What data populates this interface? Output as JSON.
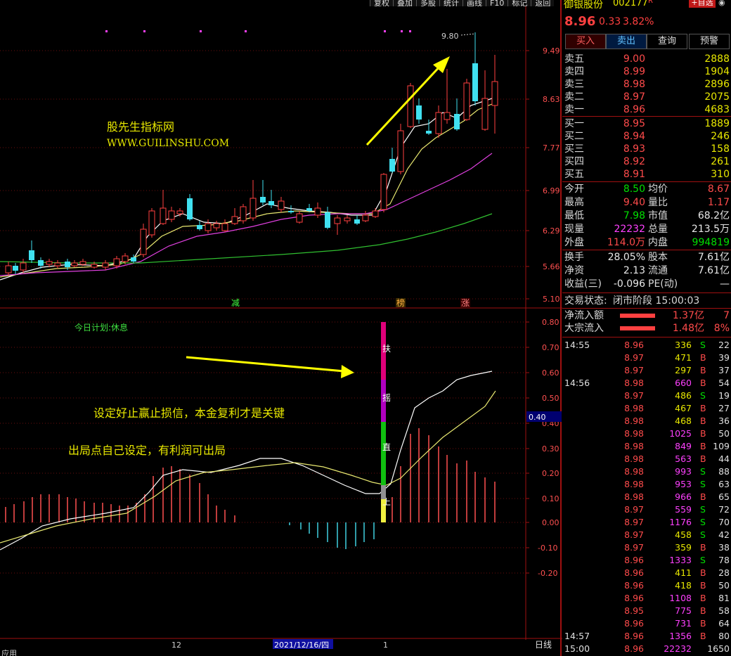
{
  "toolbar": [
    "复权",
    "叠加",
    "多股",
    "统计",
    "画线",
    "F10",
    "标记",
    "返回"
  ],
  "stock": {
    "name": "御银股份",
    "code": "002177",
    "flag": "R",
    "tag": "+自选"
  },
  "quote": {
    "price": "8.96",
    "change": "0.33",
    "pct": "3.82%"
  },
  "buttons": [
    "买入",
    "卖出",
    "查询",
    "预警"
  ],
  "asks": [
    {
      "label": "卖五",
      "price": "9.00",
      "vol": "2888"
    },
    {
      "label": "卖四",
      "price": "8.99",
      "vol": "1904"
    },
    {
      "label": "卖三",
      "price": "8.98",
      "vol": "2896"
    },
    {
      "label": "卖二",
      "price": "8.97",
      "vol": "2075"
    },
    {
      "label": "卖一",
      "price": "8.96",
      "vol": "4683"
    }
  ],
  "bids": [
    {
      "label": "买一",
      "price": "8.95",
      "vol": "1889"
    },
    {
      "label": "买二",
      "price": "8.94",
      "vol": "246"
    },
    {
      "label": "买三",
      "price": "8.93",
      "vol": "158"
    },
    {
      "label": "买四",
      "price": "8.92",
      "vol": "261"
    },
    {
      "label": "买五",
      "price": "8.91",
      "vol": "310"
    }
  ],
  "stats": [
    {
      "l1": "今开",
      "v1": "8.50",
      "c1": "grn",
      "l2": "均价",
      "v2": "8.67",
      "c2": "red"
    },
    {
      "l1": "最高",
      "v1": "9.40",
      "c1": "red",
      "l2": "量比",
      "v2": "1.17",
      "c2": "red"
    },
    {
      "l1": "最低",
      "v1": "7.98",
      "c1": "grn",
      "l2": "市值",
      "v2": "68.2亿",
      "c2": "wht"
    },
    {
      "l1": "现量",
      "v1": "22232",
      "c1": "mag",
      "l2": "总量",
      "v2": "213.5万",
      "c2": "wht"
    },
    {
      "l1": "外盘",
      "v1": "114.0万",
      "c1": "red",
      "l2": "内盘",
      "v2": "994819",
      "c2": "grn"
    }
  ],
  "stats2": [
    {
      "l1": "换手",
      "v1": "28.05%",
      "l2": "股本",
      "v2": "7.61亿"
    },
    {
      "l1": "净资",
      "v1": "2.13",
      "l2": "流通",
      "v2": "7.61亿"
    },
    {
      "l1": "收益(三)",
      "v1": "-0.096",
      "l2": "PE(动)",
      "v2": "—"
    }
  ],
  "trade_status": {
    "label": "交易状态:",
    "value": "闭市阶段 15:00:03"
  },
  "flows": [
    {
      "label": "净流入额",
      "value": "1.37亿",
      "pct": "7"
    },
    {
      "label": "大宗流入",
      "value": "1.48亿",
      "pct": "8%"
    }
  ],
  "ticks": [
    {
      "t": "14:55",
      "p": "8.96",
      "v": "336",
      "s": "S",
      "n": "22"
    },
    {
      "t": "",
      "p": "8.97",
      "v": "471",
      "s": "B",
      "n": "39"
    },
    {
      "t": "",
      "p": "8.97",
      "v": "297",
      "s": "B",
      "n": "37"
    },
    {
      "t": "14:56",
      "p": "8.98",
      "v": "660",
      "s": "B",
      "n": "54"
    },
    {
      "t": "",
      "p": "8.97",
      "v": "486",
      "s": "S",
      "n": "19"
    },
    {
      "t": "",
      "p": "8.98",
      "v": "467",
      "s": "B",
      "n": "27"
    },
    {
      "t": "",
      "p": "8.98",
      "v": "468",
      "s": "B",
      "n": "36"
    },
    {
      "t": "",
      "p": "8.98",
      "v": "1025",
      "s": "B",
      "n": "50"
    },
    {
      "t": "",
      "p": "8.98",
      "v": "849",
      "s": "B",
      "n": "109"
    },
    {
      "t": "",
      "p": "8.98",
      "v": "563",
      "s": "B",
      "n": "44"
    },
    {
      "t": "",
      "p": "8.98",
      "v": "993",
      "s": "S",
      "n": "88"
    },
    {
      "t": "",
      "p": "8.98",
      "v": "953",
      "s": "S",
      "n": "63"
    },
    {
      "t": "",
      "p": "8.98",
      "v": "966",
      "s": "B",
      "n": "65"
    },
    {
      "t": "",
      "p": "8.97",
      "v": "559",
      "s": "S",
      "n": "72"
    },
    {
      "t": "",
      "p": "8.97",
      "v": "1176",
      "s": "S",
      "n": "70"
    },
    {
      "t": "",
      "p": "8.97",
      "v": "458",
      "s": "S",
      "n": "42"
    },
    {
      "t": "",
      "p": "8.97",
      "v": "359",
      "s": "B",
      "n": "38"
    },
    {
      "t": "",
      "p": "8.96",
      "v": "1333",
      "s": "S",
      "n": "78"
    },
    {
      "t": "",
      "p": "8.96",
      "v": "411",
      "s": "B",
      "n": "28"
    },
    {
      "t": "",
      "p": "8.96",
      "v": "418",
      "s": "B",
      "n": "50"
    },
    {
      "t": "",
      "p": "8.96",
      "v": "1108",
      "s": "B",
      "n": "81"
    },
    {
      "t": "",
      "p": "8.95",
      "v": "775",
      "s": "B",
      "n": "58"
    },
    {
      "t": "",
      "p": "8.96",
      "v": "731",
      "s": "B",
      "n": "64"
    },
    {
      "t": "14:57",
      "p": "8.96",
      "v": "1356",
      "s": "B",
      "n": "80"
    },
    {
      "t": "15:00",
      "p": "8.96",
      "v": "22232",
      "s": "",
      "n": "1650"
    }
  ],
  "chart": {
    "price_axis": [
      "9.49",
      "8.63",
      "7.77",
      "6.99",
      "6.29",
      "5.66",
      "5.10"
    ],
    "ind_axis": [
      "0.80",
      "0.70",
      "0.60",
      "0.50",
      "0.40",
      "0.30",
      "0.20",
      "0.10",
      "0.00",
      "-0.10",
      "-0.20"
    ],
    "cursor_value": "0.40",
    "high_label": "9.80",
    "watermark1": "股先生指标网",
    "watermark2": "WWW.GUILINSHU.COM",
    "plan": "今日计划:休息",
    "note1": "设定好止赢止损信，本金复利才是关键",
    "note2": "出局点自己设定，有利润可出局",
    "marks": [
      "减",
      "榜",
      "涨"
    ],
    "bar_labels": [
      "扶",
      "摇",
      "直",
      "上"
    ],
    "date_labels": [
      "12",
      "2021/12/16/四",
      "1"
    ],
    "period": "日线",
    "bottom_left": "应用"
  },
  "colors": {
    "up": "#ff4040",
    "down": "#40e0f0",
    "ma5": "#ffffff",
    "ma10": "#e8e870",
    "ma20": "#e040e0",
    "ma60": "#30c030",
    "bg": "#000000",
    "grid": "#a01010"
  }
}
